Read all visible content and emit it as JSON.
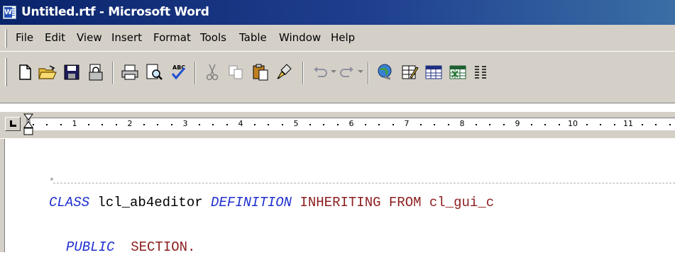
{
  "window": {
    "title": "Untitled.rtf - Microsoft Word",
    "icon": "word-document-icon"
  },
  "menu": {
    "items": [
      {
        "label": "File"
      },
      {
        "label": "Edit"
      },
      {
        "label": "View"
      },
      {
        "label": "Insert"
      },
      {
        "label": "Format"
      },
      {
        "label": "Tools"
      },
      {
        "label": "Table"
      },
      {
        "label": "Window"
      },
      {
        "label": "Help"
      }
    ]
  },
  "toolbar": {
    "buttons": [
      "new-document-icon",
      "open-folder-icon",
      "save-icon",
      "permission-icon",
      "print-icon",
      "print-preview-icon",
      "spelling-check-icon",
      "cut-icon",
      "copy-icon",
      "paste-icon",
      "format-painter-icon",
      "undo-icon",
      "redo-icon",
      "insert-hyperlink-icon",
      "tables-borders-icon",
      "insert-table-icon",
      "insert-excel-icon",
      "columns-icon"
    ]
  },
  "ruler": {
    "numbers": [
      "1",
      "2",
      "3",
      "4",
      "5",
      "6",
      "7",
      "8",
      "9",
      "10",
      "11"
    ]
  },
  "document": {
    "comment_star": "*",
    "line1": {
      "kw1": "CLASS",
      "name": " lcl_ab4editor ",
      "kw2": "DEFINITION",
      "rest": " INHERITING FROM cl_gui_c"
    },
    "line2": {
      "kw1": "PUBLIC",
      "rest": "  SECTION."
    }
  },
  "colors": {
    "title_bar": "#0a246a",
    "chrome": "#d4d0c8",
    "keyword_blue": "#1f2fd0",
    "keyword_red": "#8b1e1e"
  }
}
